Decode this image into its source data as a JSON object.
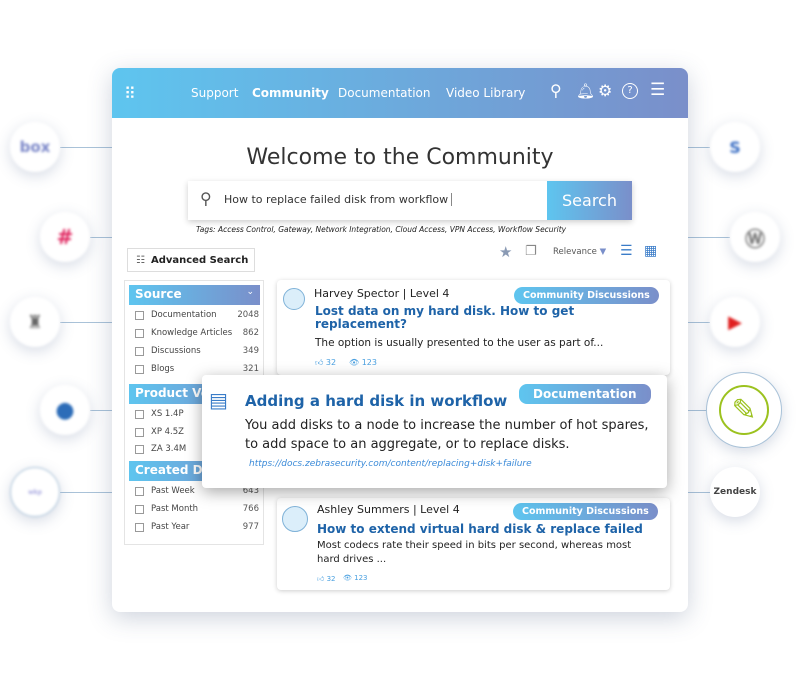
{
  "integrations": {
    "left": [
      "box",
      "slack",
      "jenkins",
      "drupal",
      "workplace"
    ],
    "right": [
      "sharepoint",
      "wordpress",
      "youtube",
      "feather",
      "zendesk"
    ]
  },
  "header": {
    "nav": [
      "Support",
      "Community",
      "Documentation",
      "Video Library"
    ],
    "active": "Community",
    "icons": [
      "apps-grid-icon",
      "search-icon",
      "bell-icon",
      "gear-icon",
      "help-icon",
      "menu-icon"
    ]
  },
  "main": {
    "title": "Welcome to the Community",
    "search": {
      "value": "How to replace failed disk from workflow",
      "button": "Search"
    },
    "tags": "Tags: Access Control, Gateway, Network Integration, Cloud Access, VPN Access, Workflow Security",
    "advanced_search": "Advanced Search",
    "sort": "Relevance"
  },
  "filters": [
    {
      "title": "Source",
      "items": [
        {
          "label": "Documentation",
          "count": "2048"
        },
        {
          "label": "Knowledge Articles",
          "count": "862"
        },
        {
          "label": "Discussions",
          "count": "349"
        },
        {
          "label": "Blogs",
          "count": "321"
        }
      ]
    },
    {
      "title": "Product Version",
      "items": [
        {
          "label": "XS 1.4P"
        },
        {
          "label": "XP 4.5Z"
        },
        {
          "label": "ZA 3.4M"
        }
      ]
    },
    {
      "title": "Created Date",
      "items": [
        {
          "label": "Past Week",
          "count": "643"
        },
        {
          "label": "Past Month",
          "count": "766"
        },
        {
          "label": "Past Year",
          "count": "977"
        }
      ]
    }
  ],
  "results": [
    {
      "author": "Harvey Spector | Level 4",
      "badge": "Community Discussions",
      "title": "Lost data on my hard disk. How to get replacement?",
      "snippet": "The option is usually presented to the user as part of...",
      "likes": "32",
      "views": "123"
    },
    {
      "badge": "Documentation",
      "title": "Adding a hard disk in workflow",
      "snippet": "You add disks to a node to increase the number of hot spares, to add space to an aggregate, or to replace disks.",
      "url": "https://docs.zebrasecurity.com/content/replacing+disk+failure"
    },
    {
      "author": "Ashley Summers | Level 4",
      "badge": "Community Discussions",
      "title": "How to extend virtual hard disk & replace failed",
      "snippet": "Most codecs rate their speed in bits per second, whereas most hard drives ...",
      "likes": "32",
      "views": "123"
    }
  ],
  "colors": {
    "gradient_start": "#5ec5ef",
    "gradient_end": "#7a8fca",
    "title_blue": "#1e63a8"
  }
}
